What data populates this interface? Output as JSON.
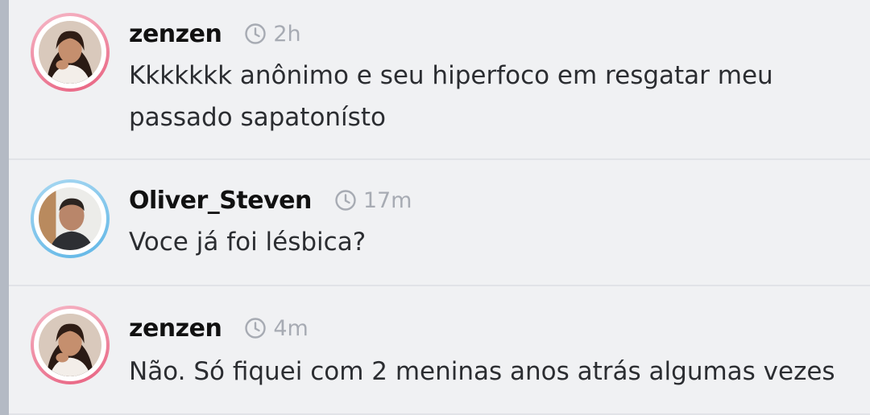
{
  "comments": [
    {
      "username": "zenzen",
      "time": "2h",
      "text": "Kkkkkkk anônimo e seu hiperfoco em resgatar meu passado sapatonísto",
      "ring_color": "#e8607f",
      "avatar": "woman-portrait-avatar"
    },
    {
      "username": "Oliver_Steven",
      "time": "17m",
      "text": "Voce já foi lésbica?",
      "ring_color": "#5fb6e6",
      "avatar": "man-portrait-avatar"
    },
    {
      "username": "zenzen",
      "time": "4m",
      "text": "Não. Só fiquei com 2 meninas anos atrás algumas vezes",
      "ring_color": "#e8607f",
      "avatar": "woman-portrait-avatar"
    }
  ],
  "icons": {
    "time": "clock-icon"
  },
  "colors": {
    "background": "#f0f1f3",
    "thread_line": "#b4bac4",
    "timestamp": "#a7abb3"
  }
}
